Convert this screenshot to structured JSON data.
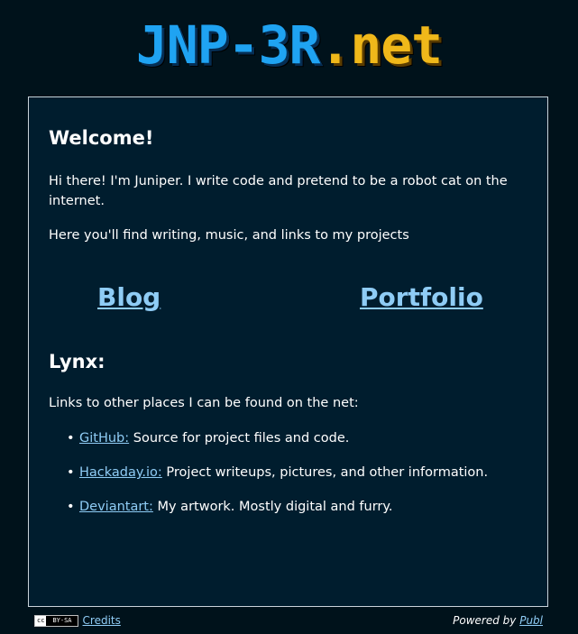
{
  "logo": {
    "main": "JNP-3R",
    "tld": ".net"
  },
  "welcome": {
    "heading": "Welcome!",
    "intro": "Hi there! I'm Juniper. I write code and pretend to be a robot cat on the internet.",
    "sub": "Here you'll find writing, music, and links to my projects"
  },
  "nav": {
    "blog": "Blog",
    "portfolio": "Portfolio"
  },
  "lynx": {
    "heading": "Lynx:",
    "intro": "Links to other places I can be found on the net:",
    "items": [
      {
        "link": "GitHub:",
        "desc": " Source for project files and code."
      },
      {
        "link": "Hackaday.io:",
        "desc": " Project writeups, pictures, and other information."
      },
      {
        "link": "Deviantart:",
        "desc": " My artwork. Mostly digital and furry."
      }
    ],
    "bullet": "•"
  },
  "footer": {
    "cc_symbol": "cc",
    "cc_license": "BY-SA",
    "credits": "Credits",
    "powered_by": "Powered by ",
    "publ": "Publ"
  },
  "colors": {
    "background": "#00121b",
    "panel": "#001d2e",
    "link": "#8fccf5",
    "logo_blue": "#1fa3f2",
    "logo_gold": "#f0b81a"
  }
}
